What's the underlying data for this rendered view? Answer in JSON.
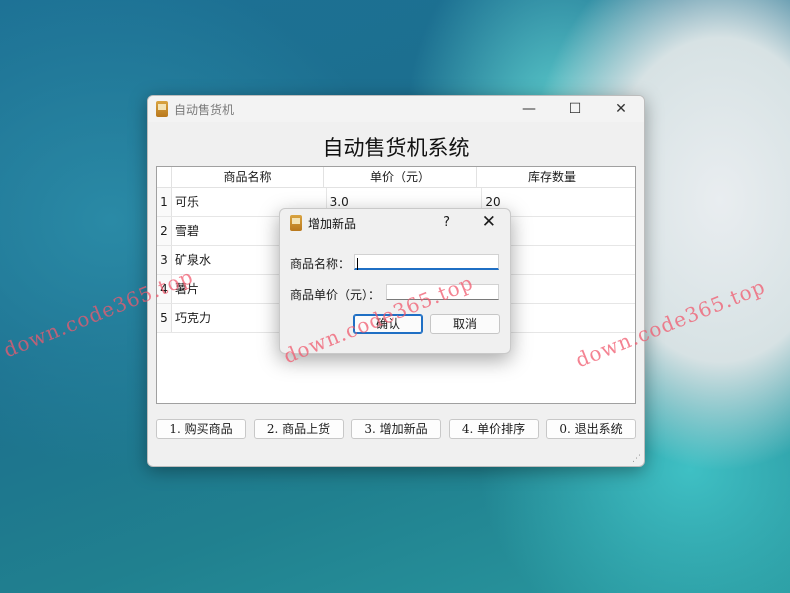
{
  "watermark": "down.code365.top",
  "main_window": {
    "title": "自动售货机",
    "controls": {
      "minimize": "—",
      "maximize": "☐",
      "close": "✕"
    },
    "heading": "自动售货机系统",
    "table": {
      "columns": [
        "商品名称",
        "单价（元）",
        "库存数量"
      ],
      "rows": [
        {
          "index": "1",
          "name": "可乐",
          "price": "3.0",
          "stock": "20"
        },
        {
          "index": "2",
          "name": "雪碧",
          "price": "",
          "stock": ""
        },
        {
          "index": "3",
          "name": "矿泉水",
          "price": "",
          "stock": ""
        },
        {
          "index": "4",
          "name": "薯片",
          "price": "",
          "stock": ""
        },
        {
          "index": "5",
          "name": "巧克力",
          "price": "",
          "stock": ""
        }
      ]
    },
    "buttons": [
      "1. 购买商品",
      "2. 商品上货",
      "3. 增加新品",
      "4. 单价排序",
      "0. 退出系统"
    ],
    "resize_grip": "⋰"
  },
  "dialog": {
    "title": "增加新品",
    "help": "?",
    "close": "✕",
    "name_label": "商品名称：",
    "name_value": "",
    "price_label": "商品单价（元）：",
    "price_value": "",
    "ok_button": "确认",
    "cancel_button": "取消"
  }
}
